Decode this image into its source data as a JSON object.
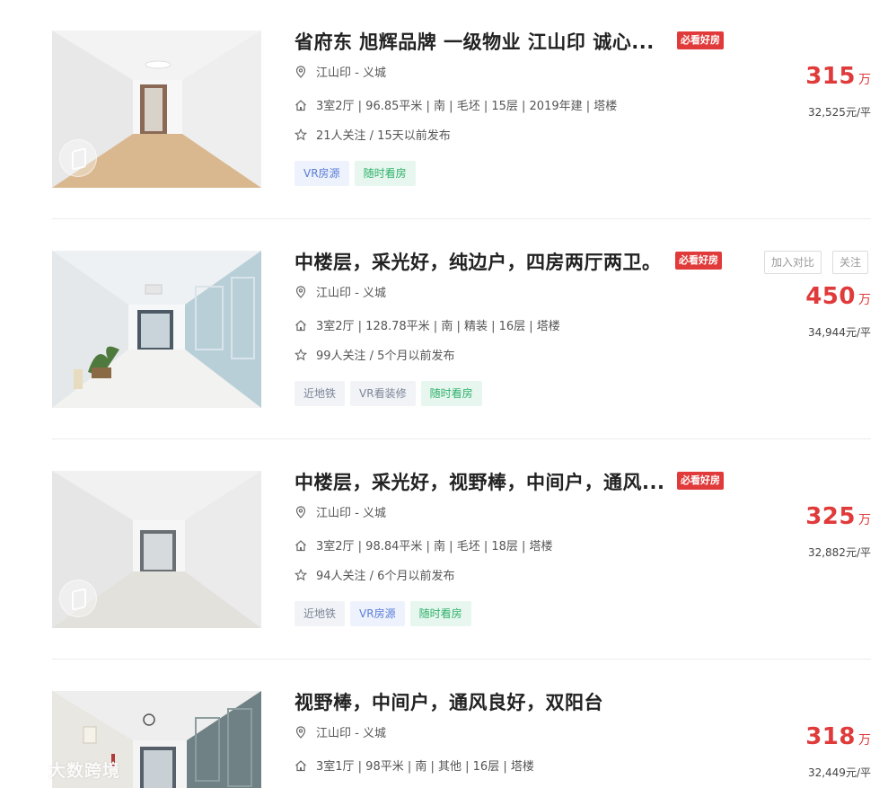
{
  "listings": [
    {
      "title": "省府东 旭辉品牌 一级物业 江山印 诚心...",
      "badge": "必看好房",
      "location": "江山印 - 义城",
      "info": "3室2厅 | 96.85平米 | 南 | 毛坯 | 15层 | 2019年建 | 塔楼",
      "follow": "21人关注 / 15天以前发布",
      "tags": [
        "VR房源",
        "随时看房"
      ],
      "price": "315",
      "price_unit": "万",
      "unit_price": "32,525元/平"
    },
    {
      "title": "中楼层，采光好，纯边户，四房两厅两卫。",
      "badge": "必看好房",
      "location": "江山印 - 义城",
      "info": "3室2厅 | 128.78平米 | 南 | 精装 | 16层 | 塔楼",
      "follow": "99人关注 / 5个月以前发布",
      "tags": [
        "近地铁",
        "VR看装修",
        "随时看房"
      ],
      "price": "450",
      "price_unit": "万",
      "unit_price": "34,944元/平",
      "compare_label": "加入对比",
      "watch_label": "关注"
    },
    {
      "title": "中楼层，采光好，视野棒，中间户，通风...",
      "badge": "必看好房",
      "location": "江山印 - 义城",
      "info": "3室2厅 | 98.84平米 | 南 | 毛坯 | 18层 | 塔楼",
      "follow": "94人关注 / 6个月以前发布",
      "tags": [
        "近地铁",
        "VR房源",
        "随时看房"
      ],
      "price": "325",
      "price_unit": "万",
      "unit_price": "32,882元/平"
    },
    {
      "title": "视野棒，中间户，通风良好，双阳台",
      "location": "江山印 - 义城",
      "info": "3室1厅 | 98平米 | 南 | 其他 | 16层 | 塔楼",
      "price": "318",
      "price_unit": "万",
      "unit_price": "32,449元/平"
    }
  ],
  "watermark": "大数跨境",
  "colors": {
    "accent": "#e03a3a",
    "vr_tag": "#5b7dd6",
    "visit_tag": "#2fb06a"
  },
  "icons": {
    "location": "location-pin-icon",
    "house": "house-icon",
    "star": "star-outline-icon"
  }
}
